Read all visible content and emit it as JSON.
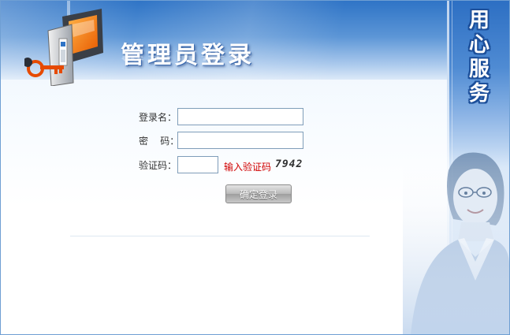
{
  "header": {
    "title": "管理员登录",
    "side_slogan": [
      "用",
      "心",
      "服",
      "务"
    ]
  },
  "form": {
    "username_label": "登录名：",
    "username_value": "",
    "password_label": "密    码：",
    "password_value": "",
    "captcha_label": "验证码：",
    "captcha_value": "",
    "captcha_hint": "输入验证码",
    "captcha_code": "7942",
    "submit_label": "确定登录"
  },
  "colors": {
    "header_blue": "#2f74c6",
    "hint_red": "#d00000",
    "field_border": "#7f9db9"
  }
}
